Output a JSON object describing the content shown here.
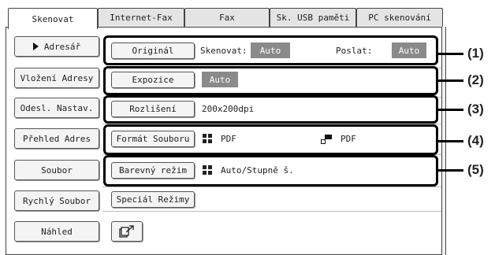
{
  "tabs": [
    {
      "label": "Skenovat",
      "active": true
    },
    {
      "label": "Internet-Fax",
      "active": false
    },
    {
      "label": "Fax",
      "active": false
    },
    {
      "label": "Sk. USB paměti",
      "active": false
    },
    {
      "label": "PC skenování",
      "active": false
    }
  ],
  "sidebar": {
    "items": [
      {
        "label": "Adresář"
      },
      {
        "label": "Vložení Adresy"
      },
      {
        "label": "Odesl. Nastav."
      },
      {
        "label": "Přehled Adres"
      },
      {
        "label": "Soubor"
      },
      {
        "label": "Rychlý Soubor"
      },
      {
        "label": "Náhled"
      }
    ]
  },
  "settings": {
    "original": {
      "button": "Originál",
      "scan_label": "Skenovat:",
      "scan_value": "Auto",
      "send_label": "Poslat:",
      "send_value": "Auto"
    },
    "exposure": {
      "button": "Expozice",
      "value": "Auto"
    },
    "resolution": {
      "button": "Rozlišení",
      "value": "200x200dpi"
    },
    "file_format": {
      "button": "Formát Souboru",
      "color_value": "PDF",
      "bw_value": "PDF"
    },
    "color_mode": {
      "button": "Barevný režim",
      "value": "Auto/Stupně š."
    },
    "special_modes": {
      "button": "Speciál Režimy"
    }
  },
  "callouts": [
    "(1)",
    "(2)",
    "(3)",
    "(4)",
    "(5)"
  ],
  "colors": {
    "value_box": "#8a8a8a",
    "callout": "#000000"
  },
  "icons": {
    "file_format_color": "color-grid-icon",
    "file_format_bw": "bw-icon",
    "color_mode": "color-grid-icon",
    "export": "export-icon"
  }
}
